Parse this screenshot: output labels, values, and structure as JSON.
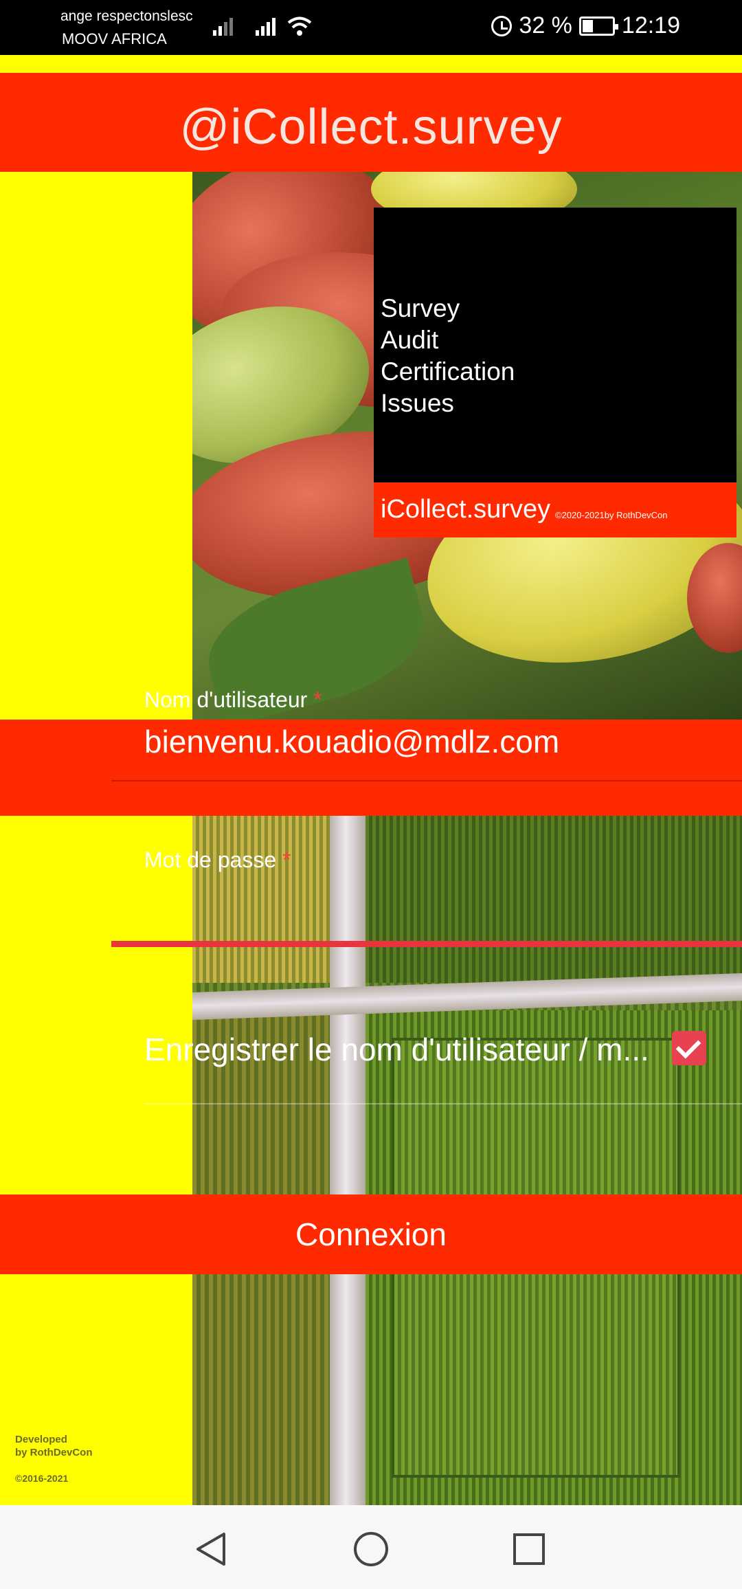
{
  "status_bar": {
    "carrier_line1": "ange respectonslesc",
    "carrier_line2": "MOOV AFRICA",
    "battery_percent": "32 %",
    "time": "12:19"
  },
  "header": {
    "app_title": "@iCollect.survey"
  },
  "promo": {
    "lines": [
      "Survey",
      "Audit",
      "Certification",
      "Issues"
    ],
    "brand": "iCollect.survey",
    "credit": "©2020-2021by RothDevCon"
  },
  "form": {
    "username_label": "Nom d'utilisateur",
    "username_value": "bienvenu.kouadio@mdlz.com",
    "password_label": "Mot de passe",
    "required_mark": "*",
    "remember_label": "Enregistrer le nom d'utilisateur / m...",
    "remember_checked": true,
    "login_label": "Connexion"
  },
  "footer": {
    "developed_line1": "Developed",
    "developed_line2": "by RothDevCon",
    "copyright": "©2016-2021"
  },
  "colors": {
    "accent_red": "#ff2a00",
    "yellow": "#ffff00",
    "checkbox": "#e8414f"
  },
  "icons": {
    "back": "triangle-back-icon",
    "home": "circle-home-icon",
    "recent": "square-recent-icon"
  }
}
